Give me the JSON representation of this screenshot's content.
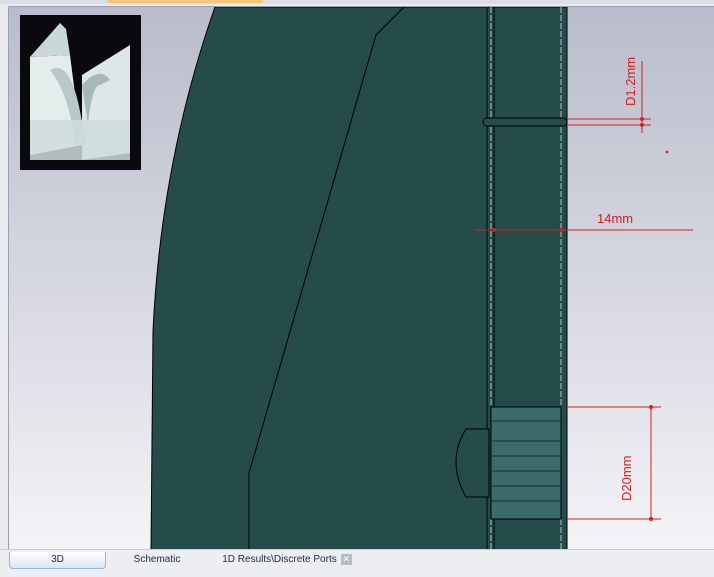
{
  "tabs": [
    {
      "label": "3D",
      "active": true
    },
    {
      "label": "Schematic"
    },
    {
      "label": "1D Results\\Discrete Ports",
      "closable": true
    }
  ],
  "dimensions": {
    "hole": "D1.2mm",
    "width": "14mm",
    "port": "D20mm"
  },
  "colors": {
    "model": "#264b4b",
    "dimension": "#d42020"
  }
}
